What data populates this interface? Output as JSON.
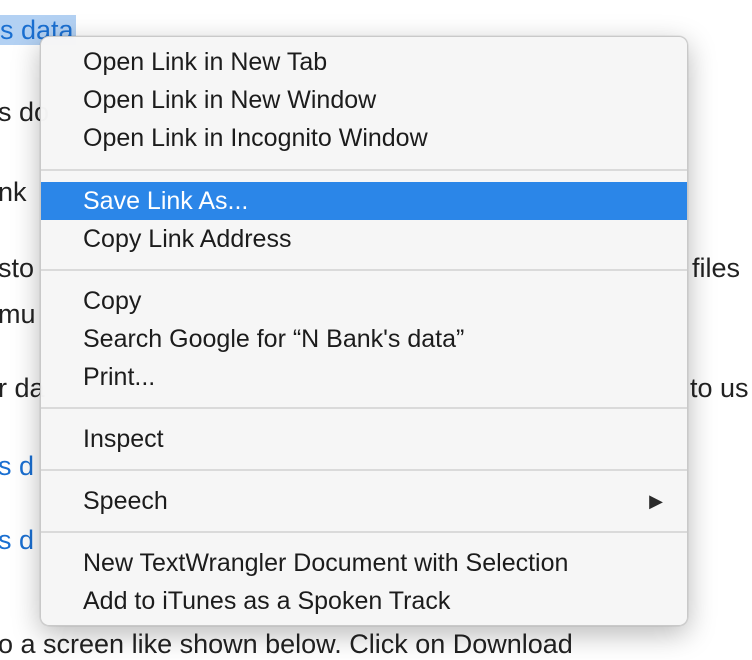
{
  "background": {
    "lines": [
      {
        "text": "s data",
        "style": "selected"
      },
      {
        "text": "s do",
        "style": "plain"
      },
      {
        "text": "nk",
        "style": "plain"
      },
      {
        "text": "sto",
        "style": "plain"
      },
      {
        "text": "files",
        "style": "plain"
      },
      {
        "text": "mu",
        "style": "plain"
      },
      {
        "text": "r da",
        "style": "plain"
      },
      {
        "text": "to us",
        "style": "plain"
      },
      {
        "text": "s d",
        "style": "link"
      },
      {
        "text": "s d",
        "style": "link"
      },
      {
        "text": "o a screen like shown below. Click on Download",
        "style": "plain"
      }
    ]
  },
  "context_menu": {
    "groups": [
      [
        "Open Link in New Tab",
        "Open Link in New Window",
        "Open Link in Incognito Window"
      ],
      [
        "Save Link As...",
        "Copy Link Address"
      ],
      [
        "Copy",
        "Search Google for “N Bank's data”",
        "Print..."
      ],
      [
        "Inspect"
      ],
      [
        "Speech"
      ],
      [
        "New TextWrangler Document with Selection",
        "Add to iTunes as a Spoken Track"
      ]
    ],
    "highlighted_item": "Save Link As...",
    "submenu_arrow": "▶",
    "highlight_color": "#2b86e8"
  }
}
